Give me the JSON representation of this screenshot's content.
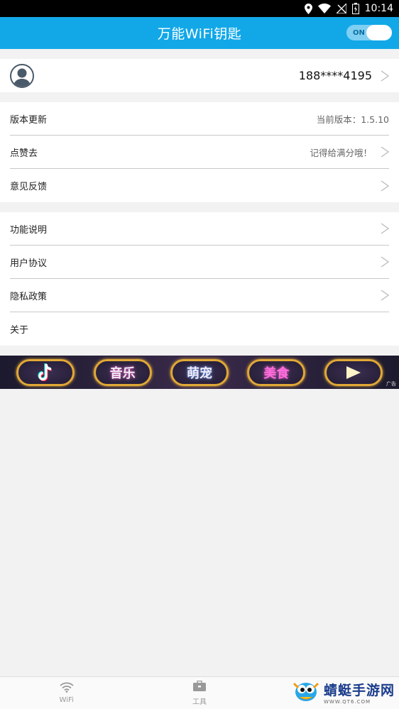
{
  "status_bar": {
    "time": "10:14",
    "icons": [
      "location-icon",
      "wifi-signal-icon",
      "no-signal-icon",
      "battery-icon"
    ]
  },
  "app_bar": {
    "title": "万能WiFi钥匙",
    "toggle_label": "ON",
    "toggle_on": true,
    "color": "#12a8e8"
  },
  "profile": {
    "avatar_icon": "user-avatar-icon",
    "phone": "188****4195"
  },
  "group1": [
    {
      "label": "版本更新",
      "value": "当前版本：1.5.10",
      "arrow": false
    },
    {
      "label": "点赞去",
      "value": "记得给满分哦！",
      "arrow": true
    },
    {
      "label": "意见反馈",
      "value": "",
      "arrow": true
    }
  ],
  "group2": [
    {
      "label": "功能说明",
      "arrow": true
    },
    {
      "label": "用户协议",
      "arrow": true
    },
    {
      "label": "隐私政策",
      "arrow": true
    },
    {
      "label": "关于",
      "arrow": false
    }
  ],
  "banner": {
    "items": [
      {
        "kind": "tiktok-icon",
        "text": ""
      },
      {
        "kind": "text",
        "text": "音乐"
      },
      {
        "kind": "text",
        "text": "萌宠"
      },
      {
        "kind": "text",
        "text": "美食"
      },
      {
        "kind": "play-icon",
        "text": ""
      }
    ],
    "ad_tag": "广告"
  },
  "bottom_nav": {
    "items": [
      {
        "label": "WiFi",
        "icon": "wifi-icon"
      },
      {
        "label": "工具",
        "icon": "toolbox-icon"
      }
    ]
  },
  "watermark": {
    "title": "蜻蜓手游网",
    "sub": "WWW.QT6.COM"
  }
}
